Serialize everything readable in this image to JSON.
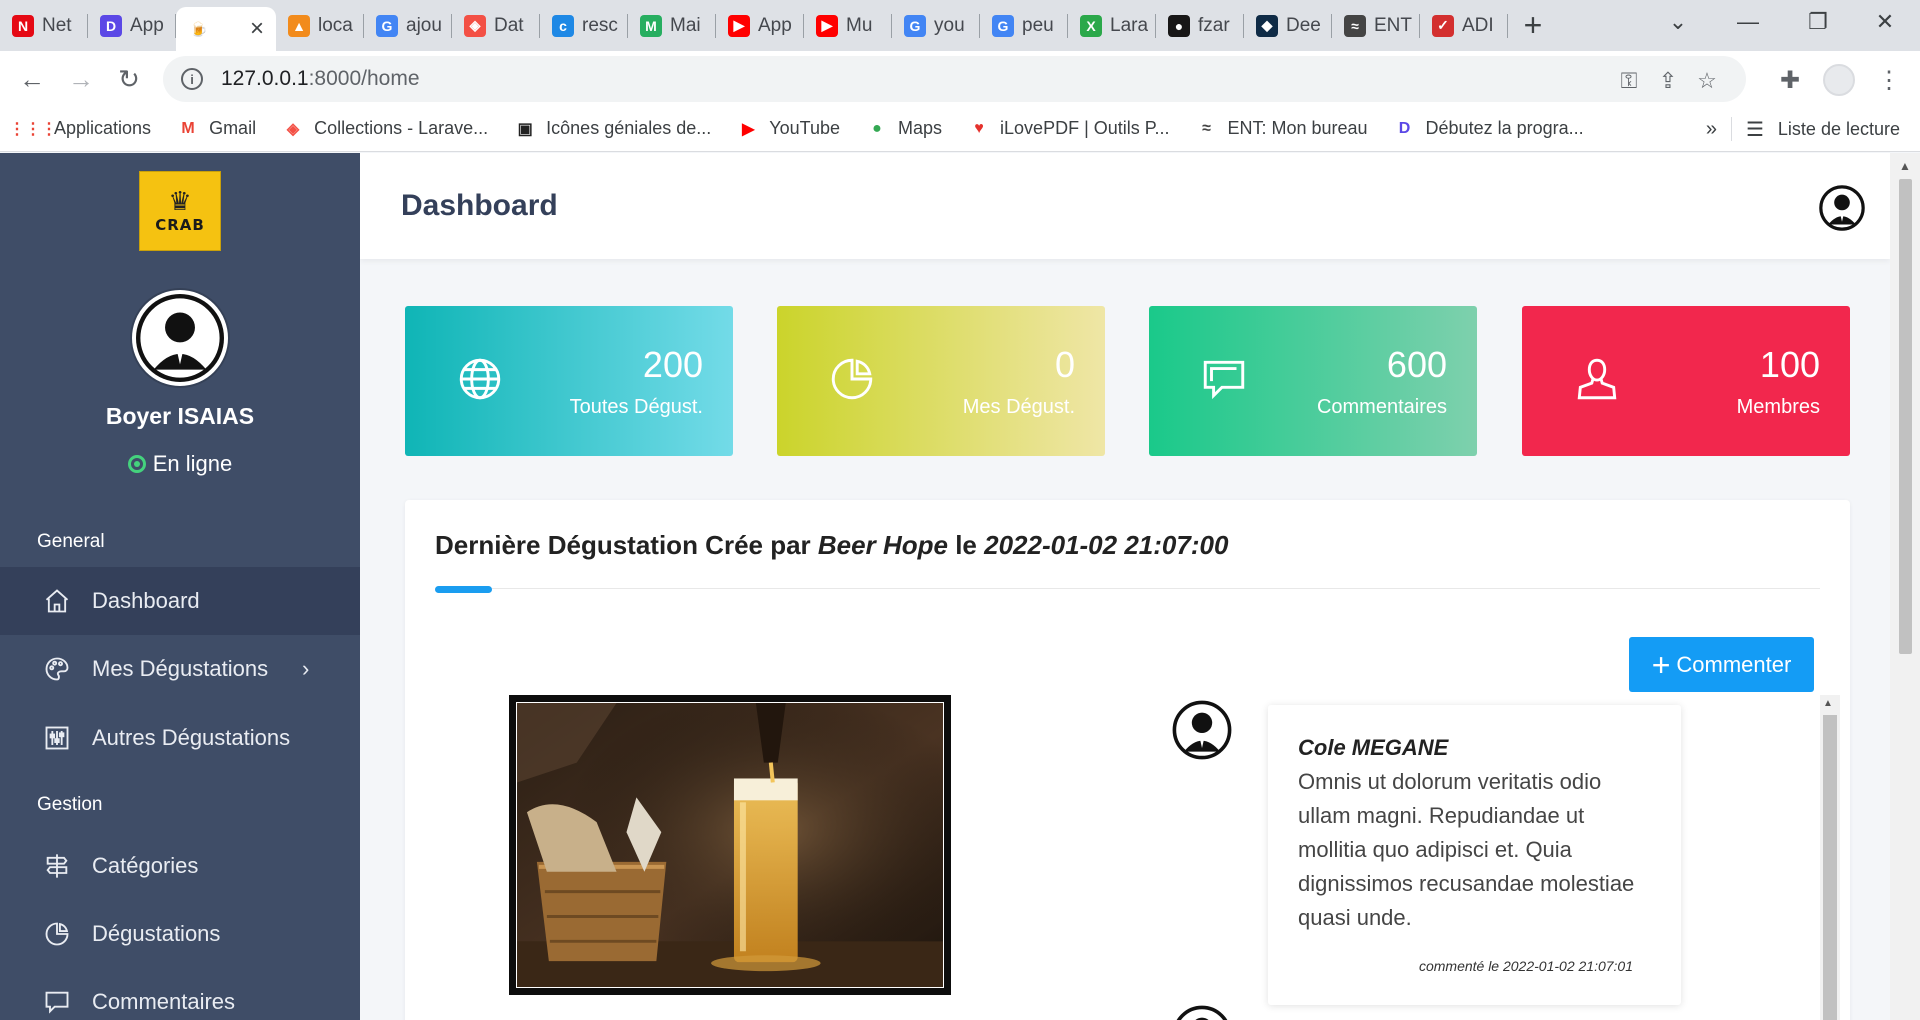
{
  "browser": {
    "tabs": [
      {
        "title": "Net",
        "color": "#e50914",
        "glyph": "N"
      },
      {
        "title": "App",
        "color": "#5b48e6",
        "glyph": "D"
      },
      {
        "title": "",
        "color": "#f0b64a",
        "glyph": "🍺",
        "active": true
      },
      {
        "title": "loca",
        "color": "#f28b1c",
        "glyph": "▲"
      },
      {
        "title": "ajou",
        "color": "#4285f4",
        "glyph": "G"
      },
      {
        "title": "Dat",
        "color": "#f35045",
        "glyph": "◈"
      },
      {
        "title": "resc",
        "color": "#1e88e5",
        "glyph": "c"
      },
      {
        "title": "Mai",
        "color": "#27ae60",
        "glyph": "M"
      },
      {
        "title": "App",
        "color": "#ff0000",
        "glyph": "▶"
      },
      {
        "title": "Mu",
        "color": "#ff0000",
        "glyph": "▶"
      },
      {
        "title": "you",
        "color": "#4285f4",
        "glyph": "G"
      },
      {
        "title": "peu",
        "color": "#4285f4",
        "glyph": "G"
      },
      {
        "title": "Lara",
        "color": "#2ba84a",
        "glyph": "X"
      },
      {
        "title": "fzar",
        "color": "#181717",
        "glyph": "●"
      },
      {
        "title": "Dee",
        "color": "#0f2b46",
        "glyph": "◆"
      },
      {
        "title": "ENT",
        "color": "#444444",
        "glyph": "≈"
      },
      {
        "title": "ADI",
        "color": "#d32f2f",
        "glyph": "✓"
      }
    ],
    "url_host": "127.0.0.1",
    "url_path": ":8000/home",
    "bookmarks": [
      {
        "label": "Applications",
        "glyph": "⋮⋮⋮",
        "color": "#ea4335"
      },
      {
        "label": "Gmail",
        "glyph": "M",
        "color": "#ea4335"
      },
      {
        "label": "Collections - Larave...",
        "glyph": "◈",
        "color": "#f35045"
      },
      {
        "label": "Icônes géniales de...",
        "glyph": "▣",
        "color": "#222222"
      },
      {
        "label": "YouTube",
        "glyph": "▶",
        "color": "#ff0000"
      },
      {
        "label": "Maps",
        "glyph": "●",
        "color": "#34a853"
      },
      {
        "label": "iLovePDF | Outils P...",
        "glyph": "♥",
        "color": "#e5322d"
      },
      {
        "label": "ENT: Mon bureau",
        "glyph": "≈",
        "color": "#444444"
      },
      {
        "label": "Débutez la progra...",
        "glyph": "D",
        "color": "#5b48e6"
      }
    ],
    "bookmarks_more": "»",
    "reading_list": "Liste de lecture"
  },
  "sidebar": {
    "logo_text": "CRAB",
    "user_name": "Boyer ISAIAS",
    "status": "En ligne",
    "sections": {
      "general": "General",
      "gestion": "Gestion"
    },
    "items": [
      {
        "label": "Dashboard",
        "icon": "home-icon",
        "active": true
      },
      {
        "label": "Mes Dégustations",
        "icon": "palette-icon",
        "has_submenu": true
      },
      {
        "label": "Autres Dégustations",
        "icon": "sliders-icon"
      },
      {
        "label": "Catégories",
        "icon": "signpost-icon"
      },
      {
        "label": "Dégustations",
        "icon": "pie-chart-icon"
      },
      {
        "label": "Commentaires",
        "icon": "chat-icon"
      }
    ]
  },
  "header": {
    "title": "Dashboard"
  },
  "stats": [
    {
      "value": "200",
      "label": "Toutes Dégust.",
      "icon": "globe-icon",
      "from": "#0fb5b6",
      "to": "#73dbe8"
    },
    {
      "value": "0",
      "label": "Mes Dégust.",
      "icon": "pie-chart-icon",
      "from": "#cbd42b",
      "to": "#efe6a6"
    },
    {
      "value": "600",
      "label": "Commentaires",
      "icon": "chat-icon",
      "from": "#1ac98a",
      "to": "#7ed0ad"
    },
    {
      "value": "100",
      "label": "Membres",
      "icon": "user-icon",
      "from": "#f2274d",
      "to": "#f2274d"
    }
  ],
  "latest": {
    "prefix": "Dernière Dégustation Crée par",
    "beer": "Beer Hope",
    "connector": "le",
    "date": "2022-01-02 21:07:00",
    "comment_button": "Commenter"
  },
  "comments": [
    {
      "author": "Cole MEGANE",
      "body": "Omnis ut dolorum veritatis odio ullam magni. Repudiandae ut mollitia quo adipisci et. Quia dignissimos recusandae molestiae quasi unde.",
      "date_label": "commenté le 2022-01-02 21:07:01"
    }
  ]
}
